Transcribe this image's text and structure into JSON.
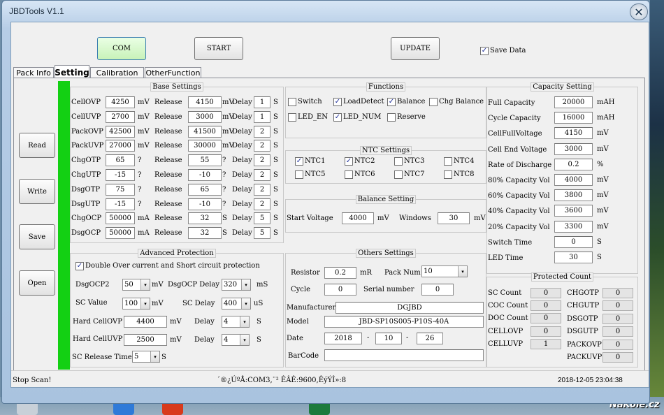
{
  "window": {
    "title": "JBDTools V1.1"
  },
  "toolbar": {
    "com": "COM",
    "start": "START",
    "update": "UPDATE",
    "save_data": "Save Data",
    "save_data_checked": true
  },
  "tabs": [
    "Pack Info",
    "Setting",
    "Calibration",
    "OtherFunction"
  ],
  "side_buttons": {
    "read": "Read",
    "write": "Write",
    "save": "Save",
    "open": "Open"
  },
  "base_settings": {
    "title": "Base Settings",
    "release_label": "Release",
    "delay_label": "Delay",
    "rows": [
      {
        "name": "CellOVP",
        "value": "4250",
        "unit": "mV",
        "release": "4150",
        "runit": "mV",
        "delay": "1",
        "dunit": "S"
      },
      {
        "name": "CellUVP",
        "value": "2700",
        "unit": "mV",
        "release": "3000",
        "runit": "mV",
        "delay": "1",
        "dunit": "S"
      },
      {
        "name": "PackOVP",
        "value": "42500",
        "unit": "mV",
        "release": "41500",
        "runit": "mV",
        "delay": "2",
        "dunit": "S"
      },
      {
        "name": "PackUVP",
        "value": "27000",
        "unit": "mV",
        "release": "30000",
        "runit": "mV",
        "delay": "2",
        "dunit": "S"
      },
      {
        "name": "ChgOTP",
        "value": "65",
        "unit": "?",
        "release": "55",
        "runit": "?",
        "delay": "2",
        "dunit": "S"
      },
      {
        "name": "ChgUTP",
        "value": "-15",
        "unit": "?",
        "release": "-10",
        "runit": "?",
        "delay": "2",
        "dunit": "S"
      },
      {
        "name": "DsgOTP",
        "value": "75",
        "unit": "?",
        "release": "65",
        "runit": "?",
        "delay": "2",
        "dunit": "S"
      },
      {
        "name": "DsgUTP",
        "value": "-15",
        "unit": "?",
        "release": "-10",
        "runit": "?",
        "delay": "2",
        "dunit": "S"
      },
      {
        "name": "ChgOCP",
        "value": "50000",
        "unit": "mA",
        "release": "32",
        "runit": "S",
        "delay": "5",
        "dunit": "S"
      },
      {
        "name": "DsgOCP",
        "value": "50000",
        "unit": "mA",
        "release": "32",
        "runit": "S",
        "delay": "5",
        "dunit": "S"
      }
    ]
  },
  "functions": {
    "title": "Functions",
    "items": [
      {
        "label": "Switch",
        "checked": false
      },
      {
        "label": "LoadDetect",
        "checked": true
      },
      {
        "label": "Balance",
        "checked": true
      },
      {
        "label": "Chg Balance",
        "checked": false
      },
      {
        "label": "LED_EN",
        "checked": false
      },
      {
        "label": "LED_NUM",
        "checked": true
      },
      {
        "label": "Reserve",
        "checked": false
      }
    ]
  },
  "ntc_settings": {
    "title": "NTC Settings",
    "items": [
      {
        "label": "NTC1",
        "checked": true
      },
      {
        "label": "NTC2",
        "checked": true
      },
      {
        "label": "NTC3",
        "checked": false
      },
      {
        "label": "NTC4",
        "checked": false
      },
      {
        "label": "NTC5",
        "checked": false
      },
      {
        "label": "NTC6",
        "checked": false
      },
      {
        "label": "NTC7",
        "checked": false
      },
      {
        "label": "NTC8",
        "checked": false
      }
    ]
  },
  "balance_setting": {
    "title": "Balance Setting",
    "start_label": "Start Voltage",
    "start_value": "4000",
    "start_unit": "mV",
    "windows_label": "Windows",
    "windows_value": "30",
    "windows_unit": "mV"
  },
  "capacity_setting": {
    "title": "Capacity Setting",
    "rows": [
      {
        "label": "Full Capacity",
        "value": "20000",
        "unit": "mAH"
      },
      {
        "label": "Cycle Capacity",
        "value": "16000",
        "unit": "mAH"
      },
      {
        "label": "CellFullVoltage",
        "value": "4150",
        "unit": "mV"
      },
      {
        "label": "Cell End Voltage",
        "value": "3000",
        "unit": "mV"
      },
      {
        "label": "Rate of Discharge",
        "value": "0.2",
        "unit": "%"
      },
      {
        "label": "80% Capacity Vol",
        "value": "4000",
        "unit": "mV"
      },
      {
        "label": "60% Capacity Vol",
        "value": "3800",
        "unit": "mV"
      },
      {
        "label": "40% Capacity Vol",
        "value": "3600",
        "unit": "mV"
      },
      {
        "label": "20% Capacity Vol",
        "value": "3300",
        "unit": "mV"
      },
      {
        "label": "Switch Time",
        "value": "0",
        "unit": "S"
      },
      {
        "label": "LED Time",
        "value": "30",
        "unit": "S"
      }
    ]
  },
  "advanced_protection": {
    "title": "Advanced Protection",
    "double_label": "Double Over current and Short circuit protection",
    "double_checked": true,
    "dsgocp2_label": "DsgOCP2",
    "dsgocp2_value": "50",
    "dsgocp2_unit": "mV",
    "dsgocp_delay_label": "DsgOCP Delay",
    "dsgocp_delay_value": "320",
    "dsgocp_delay_unit": "mS",
    "sc_value_label": "SC Value",
    "sc_value": "100",
    "sc_value_unit": "mV",
    "sc_delay_label": "SC Delay",
    "sc_delay_value": "400",
    "sc_delay_unit": "uS",
    "hard_ovp_label": "Hard CellOVP",
    "hard_ovp_value": "4400",
    "hard_ovp_unit": "mV",
    "hard_ovp_delay_label": "Delay",
    "hard_ovp_delay_value": "4",
    "hard_ovp_delay_unit": "S",
    "hard_uvp_label": "Hard CellUVP",
    "hard_uvp_value": "2500",
    "hard_uvp_unit": "mV",
    "hard_uvp_delay_label": "Delay",
    "hard_uvp_delay_value": "4",
    "hard_uvp_delay_unit": "S",
    "sc_release_label": "SC Release Time",
    "sc_release_value": "5",
    "sc_release_unit": "S"
  },
  "others_settings": {
    "title": "Others Settings",
    "resistor_label": "Resistor",
    "resistor_value": "0.2",
    "resistor_unit": "mR",
    "pack_num_label": "Pack Num",
    "pack_num_value": "10",
    "cycle_label": "Cycle",
    "cycle_value": "0",
    "serial_label": "Serial number",
    "serial_value": "0",
    "manufacturer_label": "Manufacturer",
    "manufacturer_value": "DGJBD",
    "model_label": "Model",
    "model_value": "JBD-SP10S005-P10S-40A",
    "date_label": "Date",
    "date_year": "2018",
    "date_month": "10",
    "date_day": "26",
    "date_sep": "-",
    "barcode_label": "BarCode",
    "barcode_value": ""
  },
  "protected_count": {
    "title": "Protected Count",
    "left": [
      {
        "label": "SC Count",
        "value": "0"
      },
      {
        "label": "COC Count",
        "value": "0"
      },
      {
        "label": "DOC Count",
        "value": "0"
      },
      {
        "label": "CELLOVP",
        "value": "0"
      },
      {
        "label": "CELLUVP",
        "value": "1"
      }
    ],
    "right": [
      {
        "label": "CHGOTP",
        "value": "0"
      },
      {
        "label": "CHGUTP",
        "value": "0"
      },
      {
        "label": "DSGOTP",
        "value": "0"
      },
      {
        "label": "DSGUTP",
        "value": "0"
      },
      {
        "label": "PACKOVP",
        "value": "0"
      },
      {
        "label": "PACKUVP",
        "value": "0"
      }
    ]
  },
  "status": {
    "left": "Stop Scan!",
    "center": "´®¿ÚºÅ:COM3,¨² ÊÂÊ:9600,ÊýÝÎ»:8",
    "right": "2018-12-05 23:04:38"
  },
  "watermark": "NaKole.cz",
  "colors": {
    "green_indicator": "#13d013",
    "panel": "#f0f0f0",
    "window_frame": "#b6cde6"
  }
}
